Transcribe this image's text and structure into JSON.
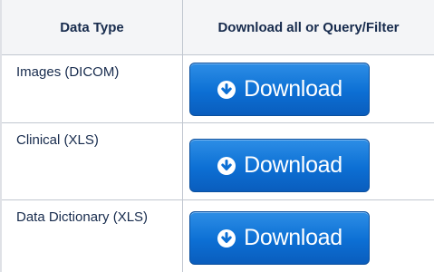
{
  "table": {
    "headers": {
      "data_type": "Data Type",
      "download": "Download all or Query/Filter"
    },
    "rows": [
      {
        "label": "Images (DICOM)",
        "button_label": "Download",
        "button_icon": "download-circle-icon"
      },
      {
        "label": "Clinical (XLS)",
        "button_label": "Download",
        "button_icon": "download-circle-icon"
      },
      {
        "label": "Data Dictionary (XLS)",
        "button_label": "Download",
        "button_icon": "download-circle-icon"
      }
    ]
  },
  "colors": {
    "button_blue": "#0c6fd4",
    "header_bg": "#f4f5f7",
    "border": "#c1c7d0"
  }
}
